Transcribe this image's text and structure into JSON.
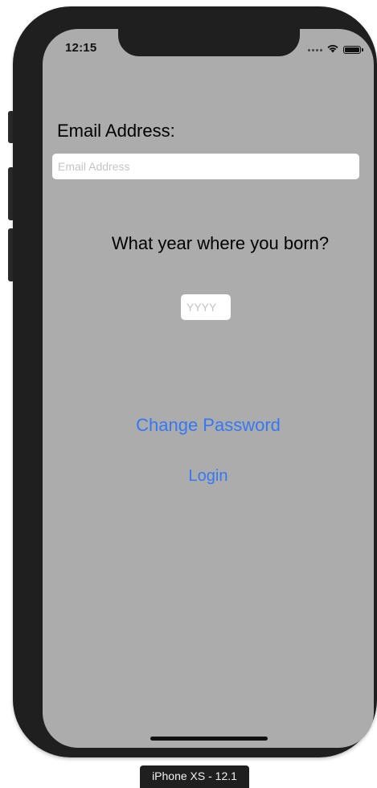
{
  "status_bar": {
    "time": "12:15",
    "icons": [
      "signal-dots-icon",
      "wifi-icon",
      "battery-icon"
    ]
  },
  "form": {
    "email_label": "Email Address:",
    "email_placeholder": "Email Address",
    "email_value": "",
    "year_question": "What year where you born?",
    "year_placeholder": "YYYY",
    "year_value": ""
  },
  "actions": {
    "change_password_label": "Change Password",
    "login_label": "Login"
  },
  "device": {
    "label": "iPhone XS - 12.1"
  },
  "colors": {
    "background": "#acacac",
    "accent": "#3478f6",
    "frame": "#1f1f1f"
  }
}
